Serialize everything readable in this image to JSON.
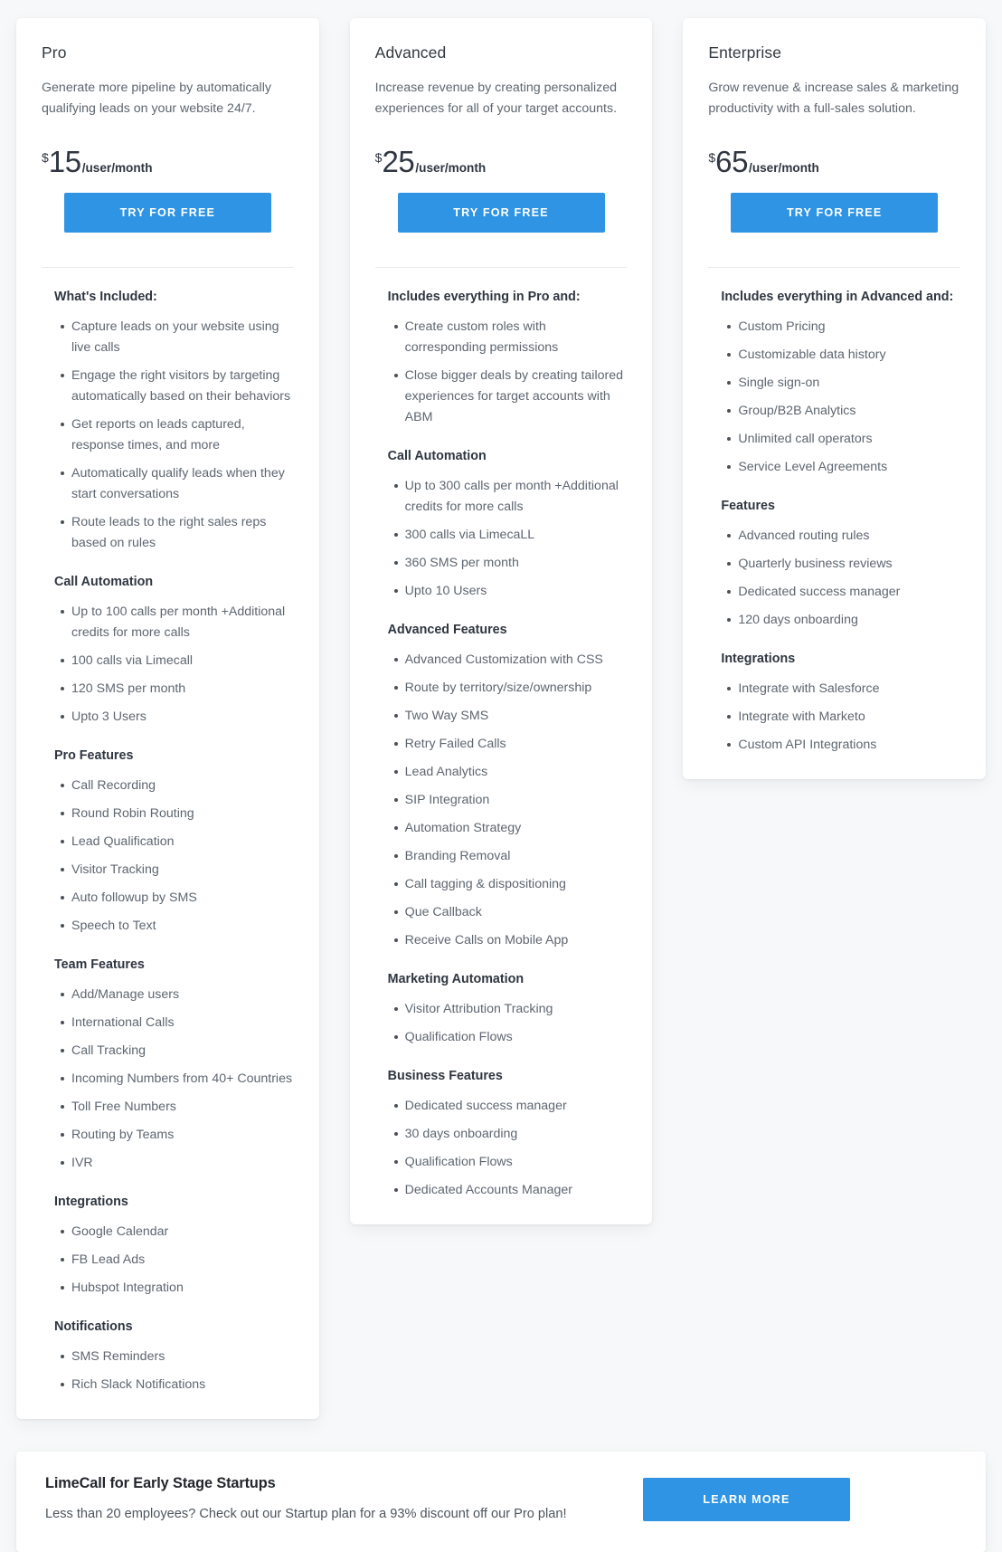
{
  "plans": [
    {
      "name": "Pro",
      "description": "Generate more pipeline by automatically qualifying leads on your website 24/7.",
      "currency": "$",
      "amount": "15",
      "period": "/user/month",
      "cta_label": "TRY FOR FREE",
      "groups": [
        {
          "heading": "What's Included:",
          "items": [
            "Capture leads on your website using live calls",
            "Engage the right visitors by targeting automatically based on their behaviors",
            "Get reports on leads captured, response times, and more",
            "Automatically qualify leads when they start conversations",
            "Route leads to the right sales reps based on rules"
          ]
        },
        {
          "heading": "Call Automation",
          "items": [
            "Up to 100 calls per month +Additional credits for more calls",
            "100 calls via Limecall",
            "120 SMS per month",
            "Upto 3 Users"
          ]
        },
        {
          "heading": "Pro Features",
          "items": [
            "Call Recording",
            "Round Robin Routing",
            "Lead Qualification",
            "Visitor Tracking",
            "Auto followup by SMS",
            "Speech to Text"
          ]
        },
        {
          "heading": "Team Features",
          "items": [
            "Add/Manage users",
            "International Calls",
            "Call Tracking",
            "Incoming Numbers from 40+ Countries",
            "Toll Free Numbers",
            "Routing by Teams",
            "IVR"
          ]
        },
        {
          "heading": "Integrations",
          "items": [
            "Google Calendar",
            "FB Lead Ads",
            "Hubspot Integration"
          ]
        },
        {
          "heading": "Notifications",
          "items": [
            "SMS Reminders",
            "Rich Slack Notifications"
          ]
        }
      ]
    },
    {
      "name": "Advanced",
      "description": "Increase revenue by creating personalized experiences for all of your target accounts.",
      "currency": "$",
      "amount": "25",
      "period": "/user/month",
      "cta_label": "TRY FOR FREE",
      "groups": [
        {
          "heading": "Includes everything in Pro and:",
          "items": [
            "Create custom roles with corresponding permissions",
            "Close bigger deals by creating tailored experiences for target accounts with ABM"
          ]
        },
        {
          "heading": "Call Automation",
          "items": [
            "Up to 300 calls per month +Additional credits for more calls",
            "300 calls via LimecaLL",
            "360 SMS per month",
            "Upto 10 Users"
          ]
        },
        {
          "heading": "Advanced Features",
          "items": [
            "Advanced Customization with CSS",
            "Route by territory/size/ownership",
            "Two Way SMS",
            "Retry Failed Calls",
            "Lead Analytics",
            "SIP Integration",
            "Automation Strategy",
            "Branding Removal",
            "Call tagging & dispositioning",
            "Que Callback",
            "Receive Calls on Mobile App"
          ]
        },
        {
          "heading": "Marketing Automation",
          "items": [
            "Visitor Attribution Tracking",
            "Qualification Flows"
          ]
        },
        {
          "heading": "Business Features",
          "items": [
            "Dedicated success manager",
            "30 days onboarding",
            "Qualification Flows",
            "Dedicated Accounts Manager"
          ]
        }
      ]
    },
    {
      "name": "Enterprise",
      "description": "Grow revenue & increase sales & marketing productivity with a full-sales solution.",
      "currency": "$",
      "amount": "65",
      "period": "/user/month",
      "cta_label": "TRY FOR FREE",
      "groups": [
        {
          "heading": "Includes everything in Advanced and:",
          "items": [
            "Custom Pricing",
            "Customizable data history",
            "Single sign-on",
            "Group/B2B Analytics",
            "Unlimited call operators",
            "Service Level Agreements"
          ]
        },
        {
          "heading": "Features",
          "items": [
            "Advanced routing rules",
            "Quarterly business reviews",
            "Dedicated success manager",
            "120 days onboarding"
          ]
        },
        {
          "heading": "Integrations",
          "items": [
            "Integrate with Salesforce",
            "Integrate with Marketo",
            "Custom API Integrations"
          ]
        }
      ]
    }
  ],
  "banner": {
    "title": "LimeCall for Early Stage Startups",
    "subtitle": "Less than 20 employees? Check out our Startup plan for a 93% discount off our Pro plan!",
    "cta_label": "LEARN MORE"
  },
  "colors": {
    "accent": "#2e94e3",
    "page_background": "#f7f8f9",
    "card_background": "#ffffff",
    "heading_text": "#2f3640",
    "body_text": "#5e6670"
  }
}
